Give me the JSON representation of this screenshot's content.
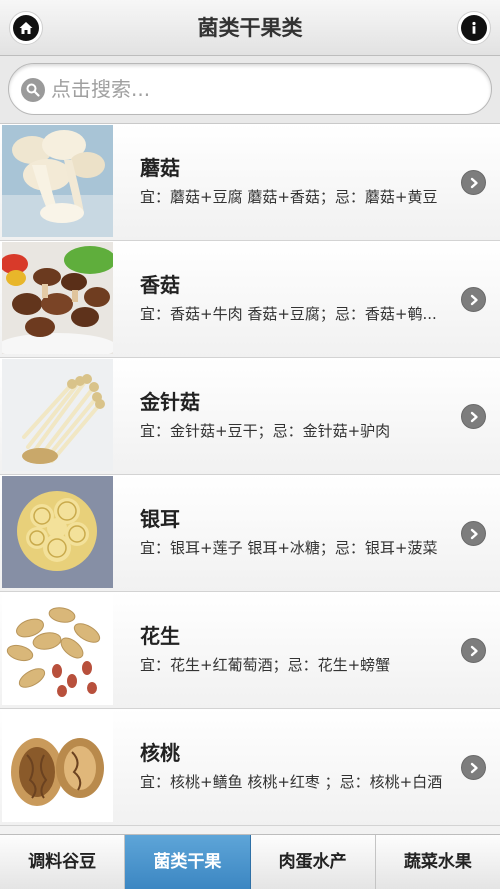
{
  "header": {
    "title": "菌类干果类",
    "home_icon": "home-icon",
    "info_icon": "info-icon"
  },
  "search": {
    "placeholder": "点击搜索...",
    "icon": "search-icon"
  },
  "items": [
    {
      "name": "蘑菇",
      "desc": "宜：蘑菇+豆腐 蘑菇+香菇；忌：蘑菇+黄豆"
    },
    {
      "name": "香菇",
      "desc": "宜：香菇+牛肉 香菇+豆腐；忌：香菇+鹌..."
    },
    {
      "name": "金针菇",
      "desc": "宜：金针菇+豆干；忌：金针菇+驴肉"
    },
    {
      "name": "银耳",
      "desc": "宜：银耳+莲子 银耳+冰糖；忌：银耳+菠菜"
    },
    {
      "name": "花生",
      "desc": "宜：花生+红葡萄酒；忌：花生+螃蟹"
    },
    {
      "name": "核桃",
      "desc": "宜：核桃+鳝鱼 核桃+红枣 ；忌：核桃+白酒"
    }
  ],
  "tabs": [
    {
      "label": "调料谷豆",
      "active": false
    },
    {
      "label": "菌类干果",
      "active": true
    },
    {
      "label": "肉蛋水产",
      "active": false
    },
    {
      "label": "蔬菜水果",
      "active": false
    }
  ],
  "colors": {
    "active_tab": "#4a94cc",
    "chevron": "#7d7d7d"
  }
}
